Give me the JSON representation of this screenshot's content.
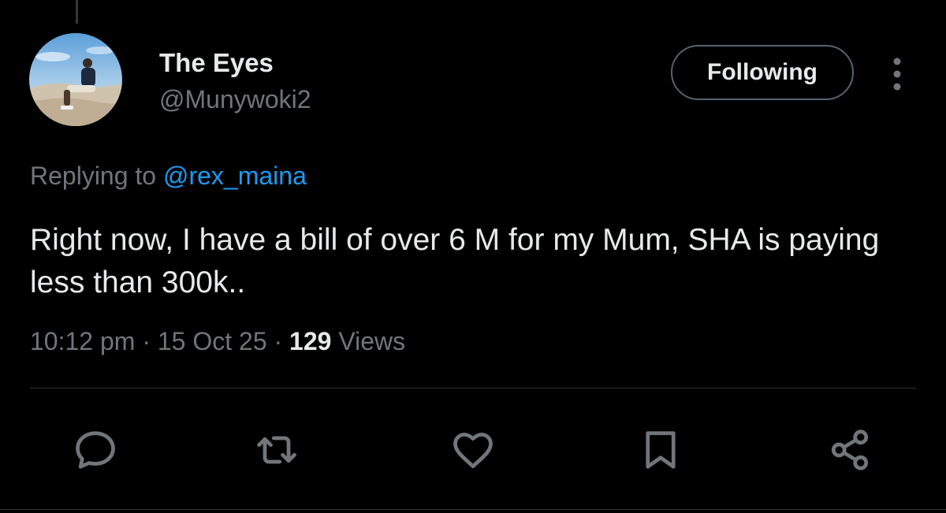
{
  "tweet": {
    "author": {
      "display_name": "The Eyes",
      "handle": "@Munywoki2"
    },
    "follow_button_label": "Following",
    "replying_prefix": "Replying to ",
    "replying_to": "@rex_maina",
    "text": "Right now, I have a bill of over 6 M for my Mum, SHA is paying less than 300k..",
    "time": "10:12 pm",
    "separator": " · ",
    "date": "15 Oct 25",
    "views_count": "129",
    "views_label": " Views"
  },
  "actions": [
    {
      "name": "reply",
      "icon": "speech-bubble-icon"
    },
    {
      "name": "repost",
      "icon": "repost-arrows-icon"
    },
    {
      "name": "like",
      "icon": "heart-icon"
    },
    {
      "name": "bookmark",
      "icon": "bookmark-icon"
    },
    {
      "name": "share",
      "icon": "share-nodes-icon"
    }
  ],
  "colors": {
    "background": "#000000",
    "primary_text": "#e7e9ea",
    "secondary_text": "#71767b",
    "link": "#1d9bf0",
    "border": "#2f3336"
  }
}
